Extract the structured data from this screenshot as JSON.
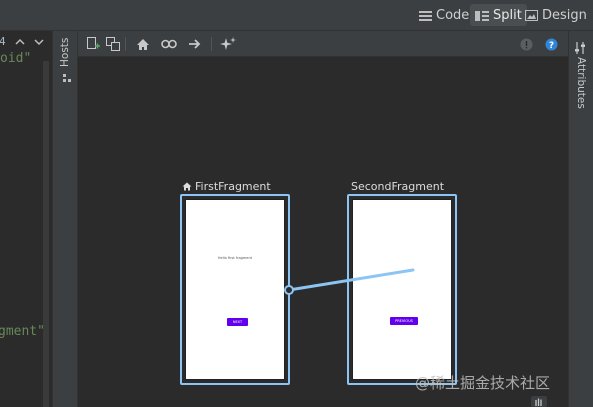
{
  "view_modes": {
    "code": "Code",
    "split": "Split",
    "design": "Design",
    "selected": "Split"
  },
  "code_snippets": {
    "line_count": "4",
    "line1": "oid\"",
    "line2": "gment\""
  },
  "side_tabs": {
    "hosts": "Hosts",
    "attributes": "Attributes"
  },
  "toolbar_icons": [
    "new-destination-icon",
    "nested-graph-icon",
    "home-icon",
    "deep-link-icon",
    "action-arrow-icon",
    "auto-arrange-icon",
    "warning-icon",
    "help-icon"
  ],
  "nav_graph": {
    "first_fragment": {
      "title": "FirstFragment",
      "start_destination": true,
      "text": "Hello first fragment",
      "button": "NEXT"
    },
    "second_fragment": {
      "title": "SecondFragment",
      "button": "PREVIOUS"
    }
  },
  "watermark": "@稀土掘金技术社区",
  "colors": {
    "selection": "#8cc4f4",
    "button": "#6200ee",
    "string": "#6a8759",
    "accent": "#2f86d8"
  }
}
